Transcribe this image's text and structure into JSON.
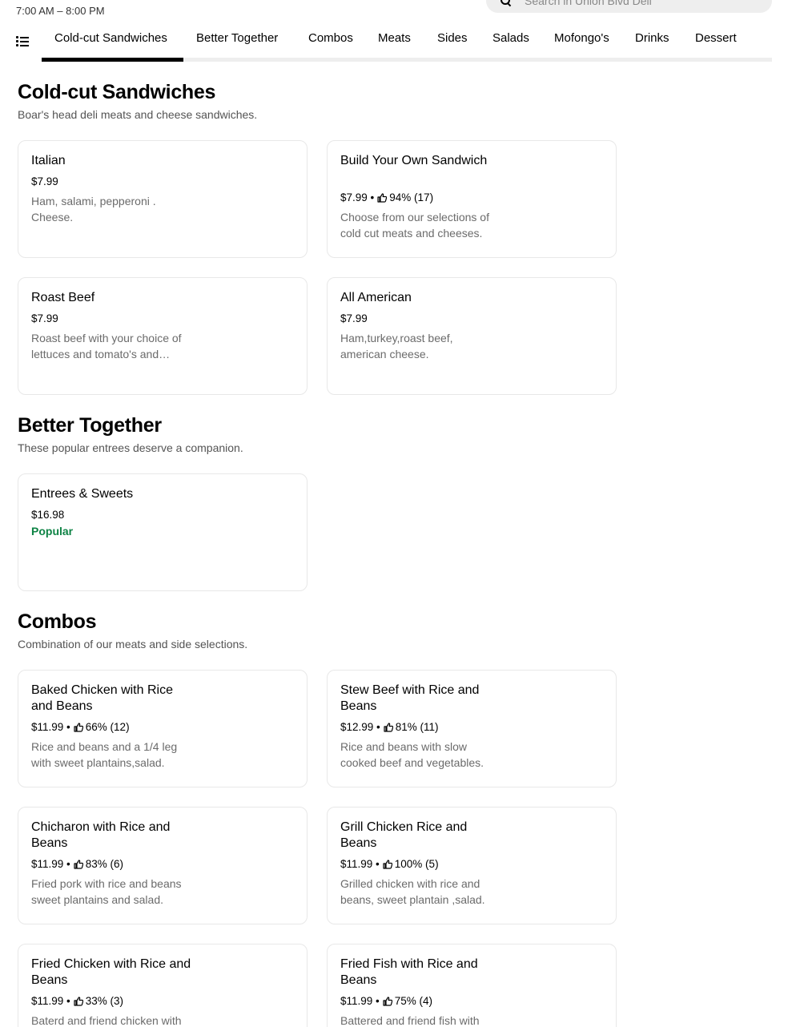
{
  "store": {
    "hours": "7:00 AM – 8:00 PM",
    "search_placeholder": "Search in Union Blvd Deli"
  },
  "nav": {
    "tabs": [
      {
        "label": "Cold-cut Sandwiches",
        "active": true
      },
      {
        "label": "Better Together"
      },
      {
        "label": "Combos"
      },
      {
        "label": "Meats"
      },
      {
        "label": "Sides"
      },
      {
        "label": "Salads"
      },
      {
        "label": "Mofongo's"
      },
      {
        "label": "Drinks"
      },
      {
        "label": "Dessert"
      }
    ]
  },
  "sections": [
    {
      "title": "Cold-cut Sandwiches",
      "subtitle": "Boar's head deli meats and cheese sandwiches.",
      "items": [
        {
          "name": "Italian",
          "price": "$7.99",
          "rating": "",
          "desc": "Ham, salami, pepperoni . Cheese."
        },
        {
          "name": "Build Your Own Sandwich",
          "price": "$7.99",
          "rating": "94% (17)",
          "desc": "Choose from our selections of cold cut meats and cheeses."
        },
        {
          "name": "Roast Beef",
          "price": "$7.99",
          "rating": "",
          "desc": "Roast beef with your choice of lettuces and tomato's and cheese."
        },
        {
          "name": "All American",
          "price": "$7.99",
          "rating": "",
          "desc": "Ham,turkey,roast beef, american cheese."
        }
      ]
    },
    {
      "title": "Better Together",
      "subtitle": "These popular entrees deserve a companion.",
      "items": [
        {
          "name": "Entrees & Sweets",
          "price": "$16.98",
          "rating": "",
          "desc": "",
          "badge": "Popular"
        }
      ]
    },
    {
      "title": "Combos",
      "subtitle": "Combination of our meats and side selections.",
      "items": [
        {
          "name": "Baked Chicken with Rice and Beans",
          "price": "$11.99",
          "rating": "66% (12)",
          "desc": "Rice and beans and a 1/4 leg with sweet plantains,salad."
        },
        {
          "name": "Stew Beef with Rice and Beans",
          "price": "$12.99",
          "rating": "81% (11)",
          "desc": "Rice and beans with slow cooked beef and vegetables."
        },
        {
          "name": "Chicharon with Rice and Beans",
          "price": "$11.99",
          "rating": "83% (6)",
          "desc": "Fried pork with rice and beans sweet plantains and salad."
        },
        {
          "name": "Grill Chicken Rice and Beans",
          "price": "$11.99",
          "rating": "100% (5)",
          "desc": "Grilled chicken with rice and beans, sweet plantain ,salad."
        },
        {
          "name": "Fried Chicken with Rice and Beans",
          "price": "$11.99",
          "rating": "33% (3)",
          "desc": "Baterd and friend chicken with rice and beans."
        },
        {
          "name": "Fried Fish with Rice and Beans",
          "price": "$11.99",
          "rating": "75% (4)",
          "desc": "Battered and friend fish with rice and beans."
        }
      ]
    }
  ],
  "colors": {
    "popular_badge": "#0e8345",
    "active_tab_bar": "#000000",
    "tab_track": "#eeeeee"
  }
}
